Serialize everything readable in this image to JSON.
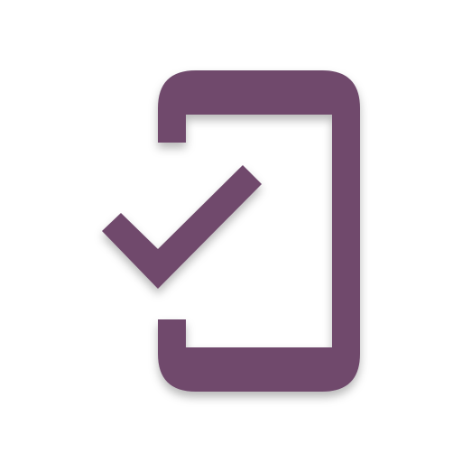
{
  "app_icon": {
    "name": "phone-check-icon",
    "description_parts": [
      "device-outline-icon",
      "check-mark-icon"
    ],
    "color": "#6f4a6c",
    "background": "#ffffff",
    "shadow_color": "rgba(0,0,0,0.28)"
  }
}
